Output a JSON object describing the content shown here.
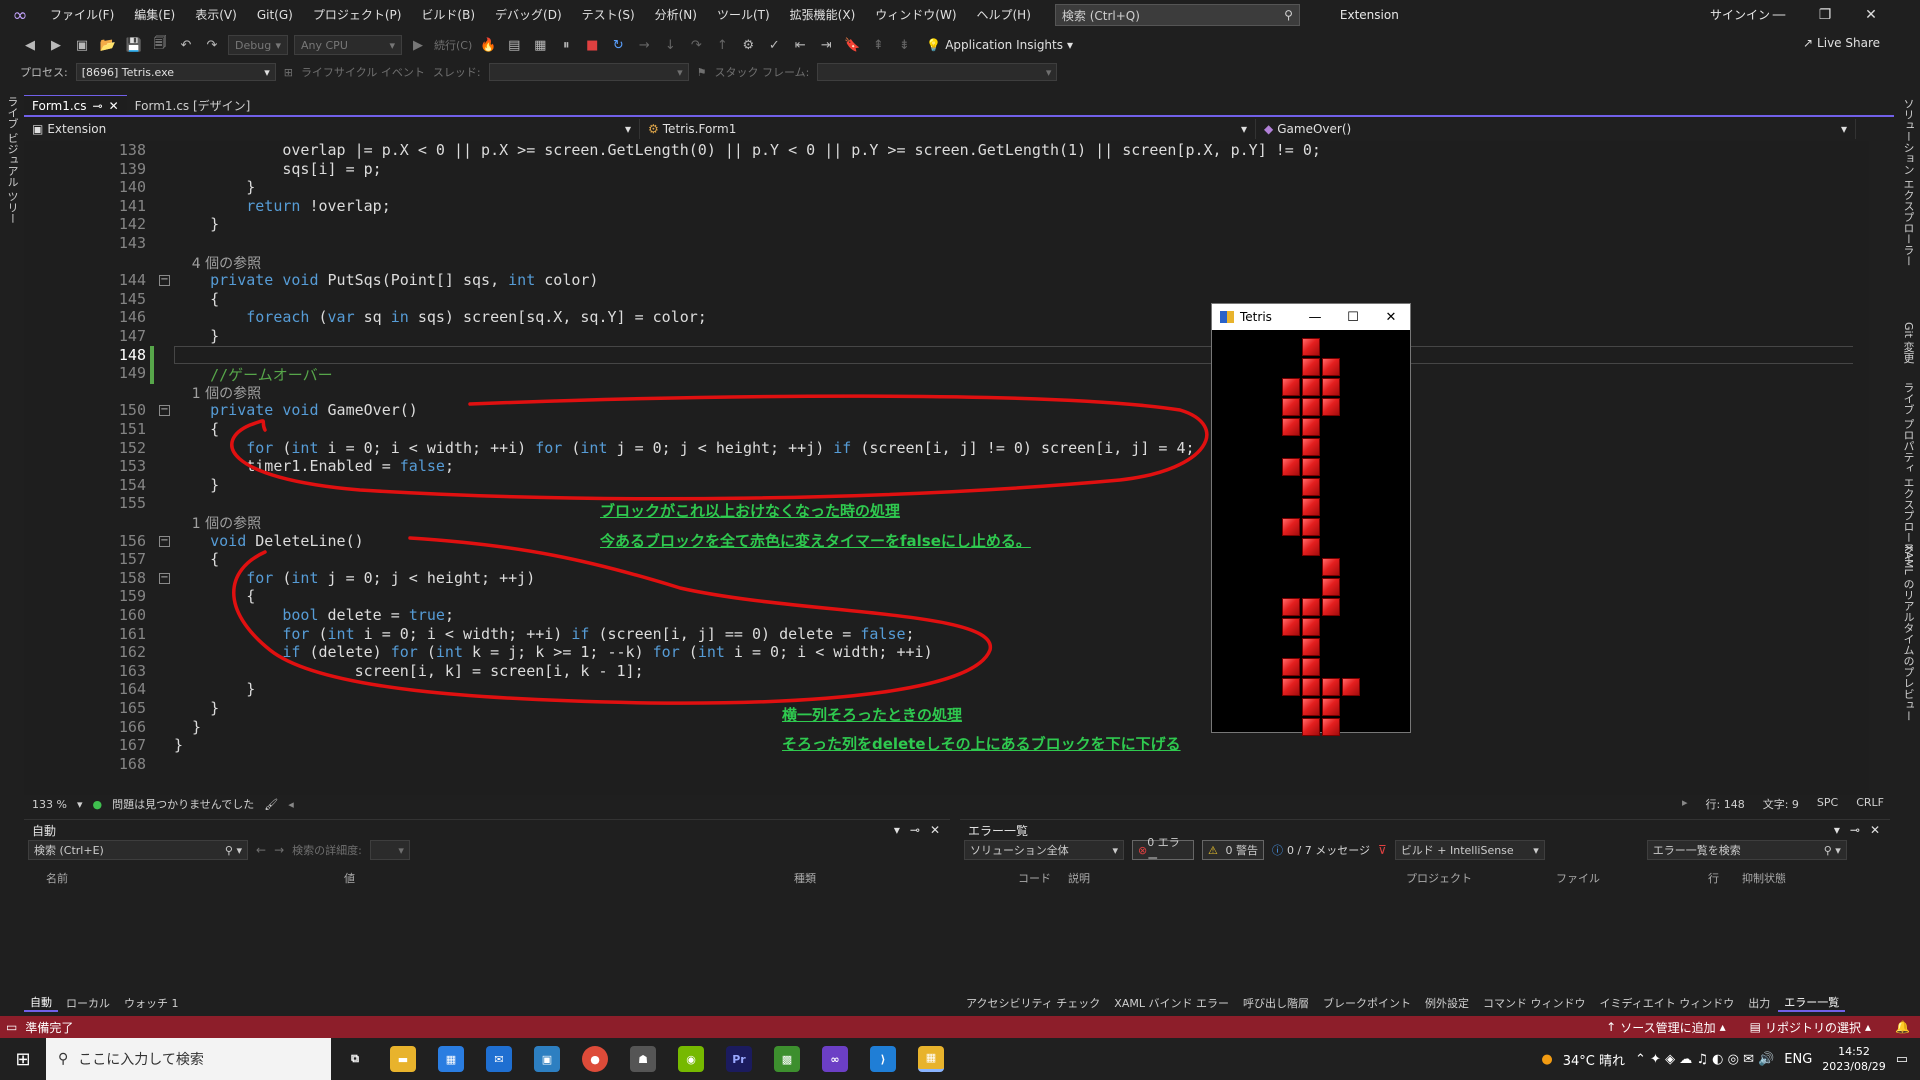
{
  "menu": {
    "items": [
      "ファイル(F)",
      "編集(E)",
      "表示(V)",
      "Git(G)",
      "プロジェクト(P)",
      "ビルド(B)",
      "デバッグ(D)",
      "テスト(S)",
      "分析(N)",
      "ツール(T)",
      "拡張機能(X)",
      "ウィンドウ(W)",
      "ヘルプ(H)"
    ],
    "search_placeholder": "検索 (Ctrl+Q)",
    "solution_name": "Extension",
    "signin": "サインイン"
  },
  "toolbar": {
    "config": "Debug",
    "platform": "Any CPU",
    "continue": "続行(C)",
    "app_insights": "Application Insights",
    "live_share": "Live Share"
  },
  "processbar": {
    "process_label": "プロセス:",
    "process_value": "[8696] Tetris.exe",
    "lifecycle": "ライフサイクル イベント",
    "thread": "スレッド:",
    "stackframe": "スタック フレーム:"
  },
  "left_strip": {
    "label": "ライブ ビジュアル ツリー"
  },
  "right_strip": {
    "labels": [
      "ソリューション エクスプローラー",
      "Git 変更",
      "ライブ プロパティ エクスプローラー",
      "XAML のリアルタイムのプレビュー"
    ]
  },
  "tabs": [
    {
      "label": "Form1.cs"
    },
    {
      "label": "Form1.cs [デザイン]"
    }
  ],
  "nav": {
    "project": "Extension",
    "class": "Tetris.Form1",
    "member": "GameOver()"
  },
  "editor": {
    "lines": [
      {
        "n": "138",
        "code": "            overlap |= p.X < 0 || p.X >= screen.GetLength(0) || p.Y < 0 || p.Y >= screen.GetLength(1) || screen[p.X, p.Y] != 0;"
      },
      {
        "n": "139",
        "code": "            sqs[i] = p;"
      },
      {
        "n": "140",
        "code": "        }"
      },
      {
        "n": "141",
        "code": "        return !overlap;"
      },
      {
        "n": "142",
        "code": "    }"
      },
      {
        "n": "143",
        "code": ""
      },
      {
        "n": "",
        "code": "    4 個の参照",
        "ref": true
      },
      {
        "n": "144",
        "code": "    private void PutSqs(Point[] sqs, int color)"
      },
      {
        "n": "145",
        "code": "    {"
      },
      {
        "n": "146",
        "code": "        foreach (var sq in sqs) screen[sq.X, sq.Y] = color;"
      },
      {
        "n": "147",
        "code": "    }"
      },
      {
        "n": "148",
        "code": ""
      },
      {
        "n": "149",
        "code": "    //ゲームオーバー",
        "comment": true
      },
      {
        "n": "",
        "code": "    1 個の参照",
        "ref": true
      },
      {
        "n": "150",
        "code": "    private void GameOver()"
      },
      {
        "n": "151",
        "code": "    {"
      },
      {
        "n": "152",
        "code": "        for (int i = 0; i < width; ++i) for (int j = 0; j < height; ++j) if (screen[i, j] != 0) screen[i, j] = 4;"
      },
      {
        "n": "153",
        "code": "        timer1.Enabled = false;"
      },
      {
        "n": "154",
        "code": "    }"
      },
      {
        "n": "155",
        "code": ""
      },
      {
        "n": "",
        "code": "    1 個の参照",
        "ref": true
      },
      {
        "n": "156",
        "code": "    void DeleteLine()"
      },
      {
        "n": "157",
        "code": "    {"
      },
      {
        "n": "158",
        "code": "        for (int j = 0; j < height; ++j)"
      },
      {
        "n": "159",
        "code": "        {"
      },
      {
        "n": "160",
        "code": "            bool delete = true;"
      },
      {
        "n": "161",
        "code": "            for (int i = 0; i < width; ++i) if (screen[i, j] == 0) delete = false;"
      },
      {
        "n": "162",
        "code": "            if (delete) for (int k = j; k >= 1; --k) for (int i = 0; i < width; ++i)"
      },
      {
        "n": "163",
        "code": "                    screen[i, k] = screen[i, k - 1];"
      },
      {
        "n": "164",
        "code": "        }"
      },
      {
        "n": "165",
        "code": "    }"
      },
      {
        "n": "166",
        "code": "  }"
      },
      {
        "n": "167",
        "code": "}"
      },
      {
        "n": "168",
        "code": ""
      }
    ],
    "current_line": "148"
  },
  "notes": {
    "gameover_1": "ブロックがこれ以上おけなくなった時の処理",
    "gameover_2": "今あるブロックを全て赤色に変えタイマーをfalseにし止める。",
    "delete_1": "横一列そろったときの処理",
    "delete_2": "そろった列をdeleteしその上にあるブロックを下に下げる"
  },
  "tetris": {
    "title": "Tetris",
    "cells": [
      [
        3,
        0
      ],
      [
        3,
        1
      ],
      [
        4,
        1
      ],
      [
        2,
        2
      ],
      [
        3,
        2
      ],
      [
        4,
        2
      ],
      [
        2,
        3
      ],
      [
        3,
        3
      ],
      [
        4,
        3
      ],
      [
        2,
        4
      ],
      [
        3,
        4
      ],
      [
        3,
        5
      ],
      [
        2,
        6
      ],
      [
        3,
        6
      ],
      [
        3,
        7
      ],
      [
        3,
        8
      ],
      [
        2,
        9
      ],
      [
        3,
        9
      ],
      [
        3,
        10
      ],
      [
        4,
        11
      ],
      [
        4,
        12
      ],
      [
        2,
        13
      ],
      [
        3,
        13
      ],
      [
        4,
        13
      ],
      [
        2,
        14
      ],
      [
        3,
        14
      ],
      [
        3,
        15
      ],
      [
        2,
        16
      ],
      [
        3,
        16
      ],
      [
        2,
        17
      ],
      [
        3,
        17
      ],
      [
        4,
        17
      ],
      [
        5,
        17
      ],
      [
        3,
        18
      ],
      [
        4,
        18
      ],
      [
        3,
        19
      ],
      [
        4,
        19
      ]
    ],
    "block_color": "#e41e1e"
  },
  "editor_status": {
    "zoom": "133 %",
    "issues": "問題は見つかりませんでした",
    "line": "行: 148",
    "char": "文字: 9",
    "spc": "SPC",
    "crlf": "CRLF"
  },
  "auto_panel": {
    "title": "自動",
    "search": "検索 (Ctrl+E)",
    "depth_label": "検索の詳細度:",
    "cols": [
      "名前",
      "値",
      "種類"
    ],
    "tabs": [
      "自動",
      "ローカル",
      "ウォッチ 1"
    ]
  },
  "error_panel": {
    "title": "エラー一覧",
    "scope": "ソリューション全体",
    "errors": "0 エラー",
    "warnings": "0 警告",
    "messages": "0 / 7 メッセージ",
    "build": "ビルド + IntelliSense",
    "search": "エラー一覧を検索",
    "cols": [
      "コード",
      "説明",
      "プロジェクト",
      "ファイル",
      "行",
      "抑制状態"
    ],
    "tabs": [
      "アクセシビリティ チェック",
      "XAML バインド エラー",
      "呼び出し階層",
      "ブレークポイント",
      "例外設定",
      "コマンド ウィンドウ",
      "イミディエイト ウィンドウ",
      "出力",
      "エラー一覧"
    ]
  },
  "statusbar": {
    "ready": "準備完了",
    "source_control": "ソース管理に追加",
    "repo": "リポジトリの選択"
  },
  "taskbar": {
    "search": "ここに入力して検索",
    "weather": "34°C 晴れ",
    "lang": "ENG",
    "time": "14:52",
    "date": "2023/08/29"
  },
  "colors": {
    "accent": "#7160e8",
    "status_bar": "#8d1e2a",
    "annotation": "#e01010",
    "note_text": "#2fc94f"
  }
}
